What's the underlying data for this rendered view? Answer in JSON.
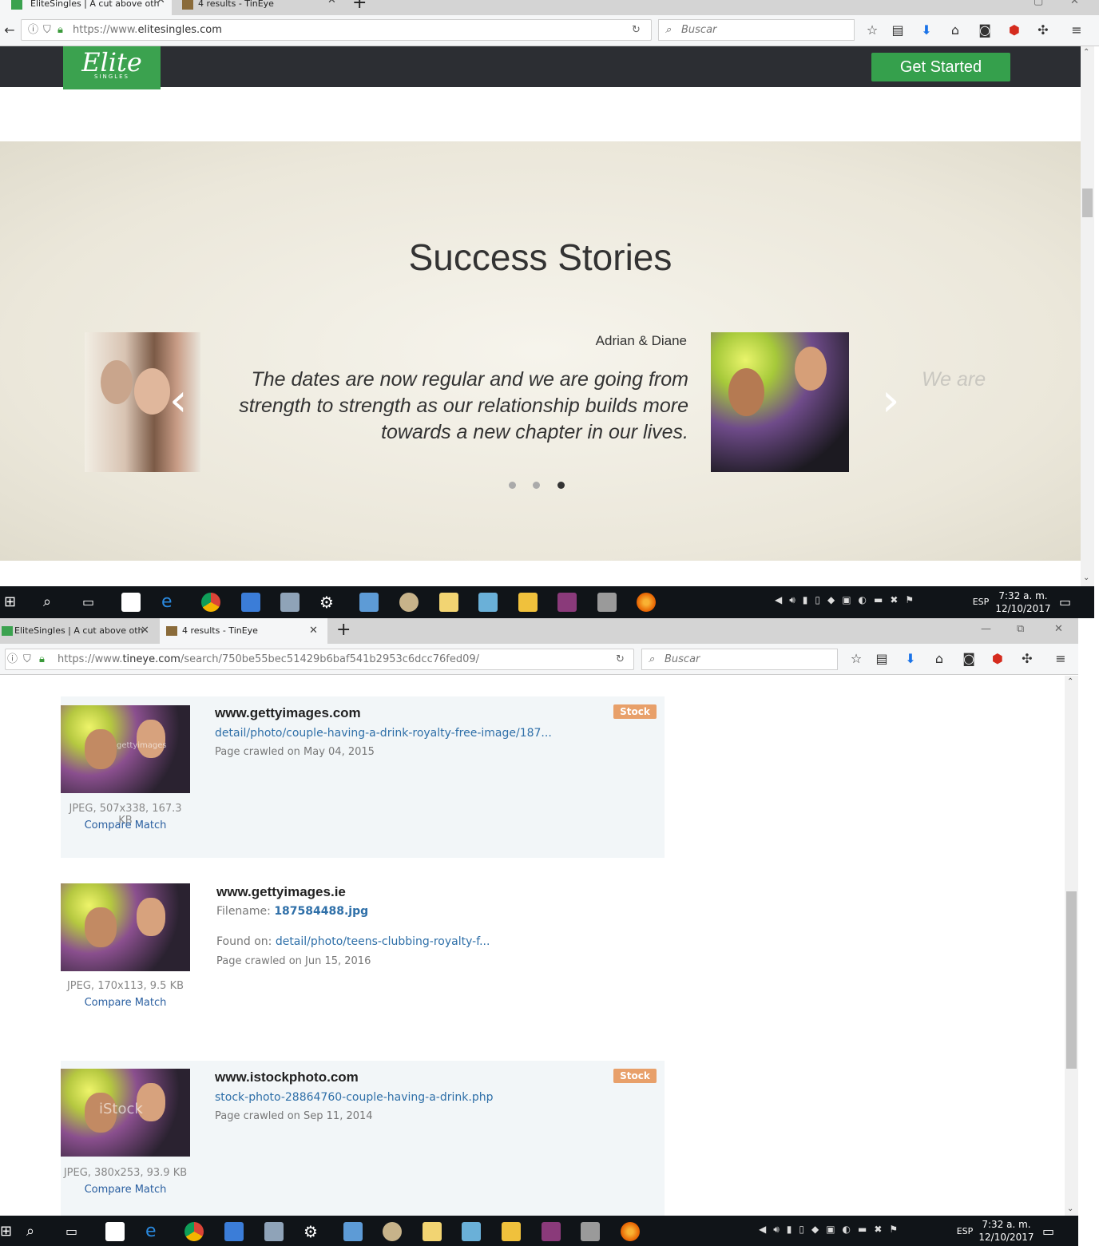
{
  "top_browser": {
    "tabs": [
      {
        "label": "EliteSingles | A cut above oth"
      },
      {
        "label": "4 results - TinEye"
      }
    ],
    "url_prefix": "https://www.",
    "url_domain": "elitesingles.com",
    "search_placeholder": "Buscar"
  },
  "elite": {
    "logo_text": "Elite",
    "logo_sub": "SINGLES",
    "cta": "Get Started",
    "section_title": "Success Stories",
    "story_name": "Adrian & Diane",
    "story_quote": "The dates are now regular and we are going from strength to strength as our relationship builds more towards a new chapter in our lives.",
    "next_quote_preview": "We are",
    "carousel_active_dot": 3
  },
  "taskbar": {
    "lang": "ESP",
    "time": "7:32 a. m.",
    "date": "12/10/2017"
  },
  "bottom_browser": {
    "tabs": [
      {
        "label": "EliteSingles | A cut above oth"
      },
      {
        "label": "4 results - TinEye"
      }
    ],
    "url_prefix": "https://www.",
    "url_domain": "tineye.com",
    "url_path": "/search/750be55bec51429b6baf541b2953c6dcc76fed09/",
    "search_placeholder": "Buscar"
  },
  "results": [
    {
      "site": "www.gettyimages.com",
      "badge": "Stock",
      "link": "detail/photo/couple-having-a-drink-royalty-free-image/187...",
      "crawled": "Page crawled on May 04, 2015",
      "meta": "JPEG, 507x338, 167.3 KB",
      "compare": "Compare Match",
      "watermark": "gettyimages"
    },
    {
      "site": "www.gettyimages.ie",
      "filename_label": "Filename:",
      "filename": "187584488.jpg",
      "found_label": "Found on:",
      "link": "detail/photo/teens-clubbing-royalty-f...",
      "crawled": "Page crawled on Jun 15, 2016",
      "meta": "JPEG, 170x113, 9.5 KB",
      "compare": "Compare Match"
    },
    {
      "site": "www.istockphoto.com",
      "badge": "Stock",
      "link": "stock-photo-28864760-couple-having-a-drink.php",
      "crawled": "Page crawled on Sep 11, 2014",
      "meta": "JPEG, 380x253, 93.9 KB",
      "compare": "Compare Match",
      "watermark": "iStock"
    }
  ],
  "colors": {
    "elite_green": "#3ba24f",
    "header_dark": "#2c2e33",
    "stock_badge": "#e8a06a",
    "link_blue": "#2e6fa8"
  }
}
